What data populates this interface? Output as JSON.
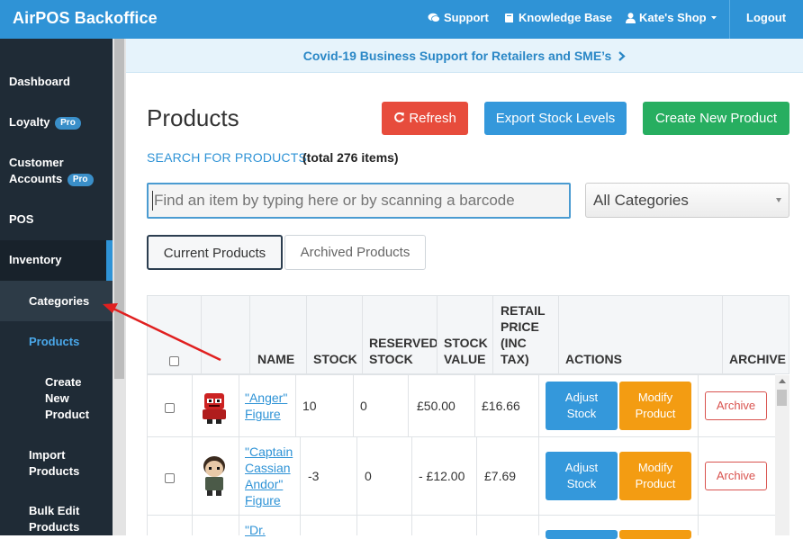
{
  "app": {
    "brand": "AirPOS Backoffice",
    "nav": {
      "support": "Support",
      "knowledge_base": "Knowledge Base",
      "shop": "Kate's Shop",
      "logout": "Logout"
    },
    "accent": "#2f93d6"
  },
  "sidebar": {
    "items": [
      {
        "label": "Dashboard"
      },
      {
        "label": "Loyalty",
        "badge": "Pro"
      },
      {
        "label_line1": "Customer",
        "label_line2": "Accounts",
        "badge": "Pro"
      },
      {
        "label": "POS"
      },
      {
        "label": "Inventory",
        "active": true
      }
    ],
    "sub_items": {
      "categories": "Categories",
      "products": "Products",
      "create_line1": "Create",
      "create_line2": "New",
      "create_line3": "Product",
      "import_line1": "Import",
      "import_line2": "Products",
      "bulk_line1": "Bulk Edit",
      "bulk_line2": "Products"
    }
  },
  "banner": {
    "text": "Covid-19 Business Support for Retailers and SME’s"
  },
  "main": {
    "title": "Products",
    "buttons": {
      "refresh": "Refresh",
      "export": "Export Stock Levels",
      "create": "Create New Product"
    },
    "search_link": "SEARCH FOR PRODUCTS",
    "total": "(total 276 items)",
    "search_placeholder": "Find an item by typing here or by scanning a barcode",
    "category_select": "All Categories",
    "tabs": {
      "current": "Current Products",
      "archived": "Archived Products"
    }
  },
  "table": {
    "headers": {
      "name": "NAME",
      "stock": "STOCK",
      "reserved_1": "RESERVED",
      "reserved_2": "STOCK",
      "value_1": "STOCK",
      "value_2": "VALUE",
      "retail_1": "RETAIL",
      "retail_2": "PRICE",
      "retail_3": "(INC",
      "retail_4": "TAX)",
      "actions": "ACTIONS",
      "archive": "ARCHIVE"
    },
    "rows": [
      {
        "name_lines": [
          "\"Anger\"",
          "Figure"
        ],
        "stock": "10",
        "reserved": "0",
        "value": "£50.00",
        "price": "£16.66"
      },
      {
        "name_lines": [
          "\"Captain",
          "Cassian",
          "Andor\"",
          "Figure"
        ],
        "stock": "-3",
        "reserved": "0",
        "value": "- £12.00",
        "price": "£7.69"
      },
      {
        "name_lines": [
          "\"Dr."
        ]
      }
    ],
    "actions": {
      "adjust_1": "Adjust",
      "adjust_2": "Stock",
      "modify_1": "Modify",
      "modify_2": "Product",
      "archive": "Archive"
    }
  }
}
